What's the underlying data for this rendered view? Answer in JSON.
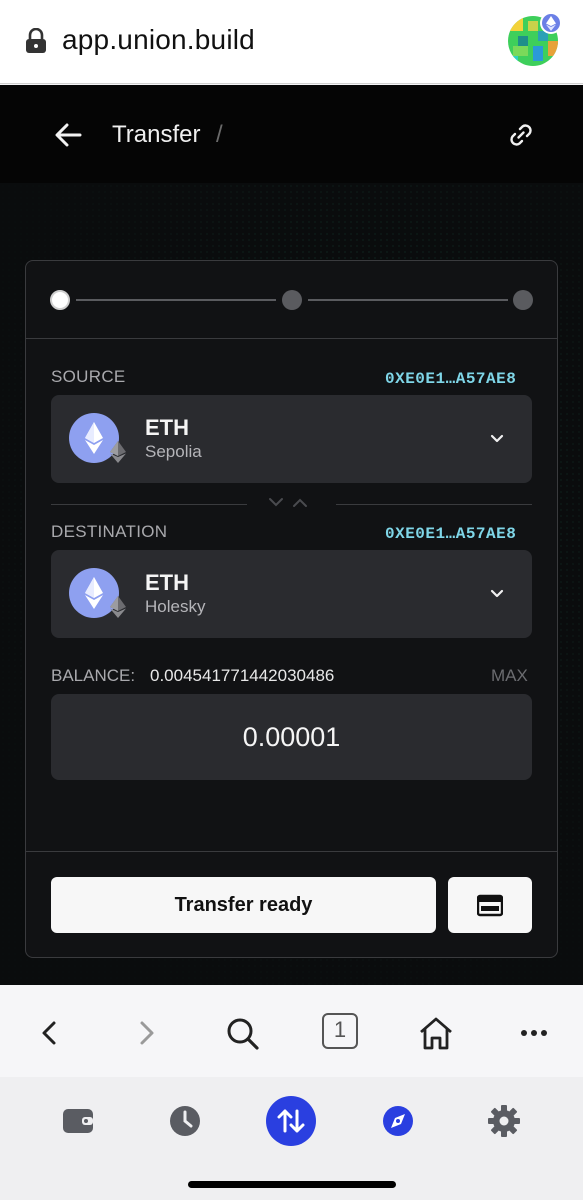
{
  "browser": {
    "url": "app.union.build",
    "icons": [
      "lock-icon",
      "avatar",
      "back-nav-icon",
      "forward-nav-icon",
      "search-icon",
      "tabs-icon",
      "home-icon",
      "more-icon"
    ],
    "tab_count": "1"
  },
  "header": {
    "title": "Transfer",
    "separator": "/",
    "icons": [
      "back-arrow-icon",
      "link-icon"
    ]
  },
  "stepper": {
    "steps": 3,
    "active_step": 1
  },
  "source": {
    "label": "SOURCE",
    "address": "0XE0E1…A57AE8",
    "asset": "ETH",
    "chain": "Sepolia"
  },
  "destination": {
    "label": "DESTINATION",
    "address": "0XE0E1…A57AE8",
    "asset": "ETH",
    "chain": "Holesky"
  },
  "balance": {
    "label": "BALANCE:",
    "value": "0.004541771442030486",
    "max_label": "MAX"
  },
  "amount": {
    "value": "0.00001"
  },
  "actions": {
    "transfer_label": "Transfer ready"
  },
  "dock": {
    "icons": [
      "wallet-icon",
      "history-icon",
      "transfer-icon",
      "explore-icon",
      "settings-icon"
    ],
    "active": "transfer-icon"
  },
  "colors": {
    "accent_address": "#7fd6e8",
    "dock_active": "#2a3fe0",
    "eth_logo": "#8ea0f0"
  }
}
